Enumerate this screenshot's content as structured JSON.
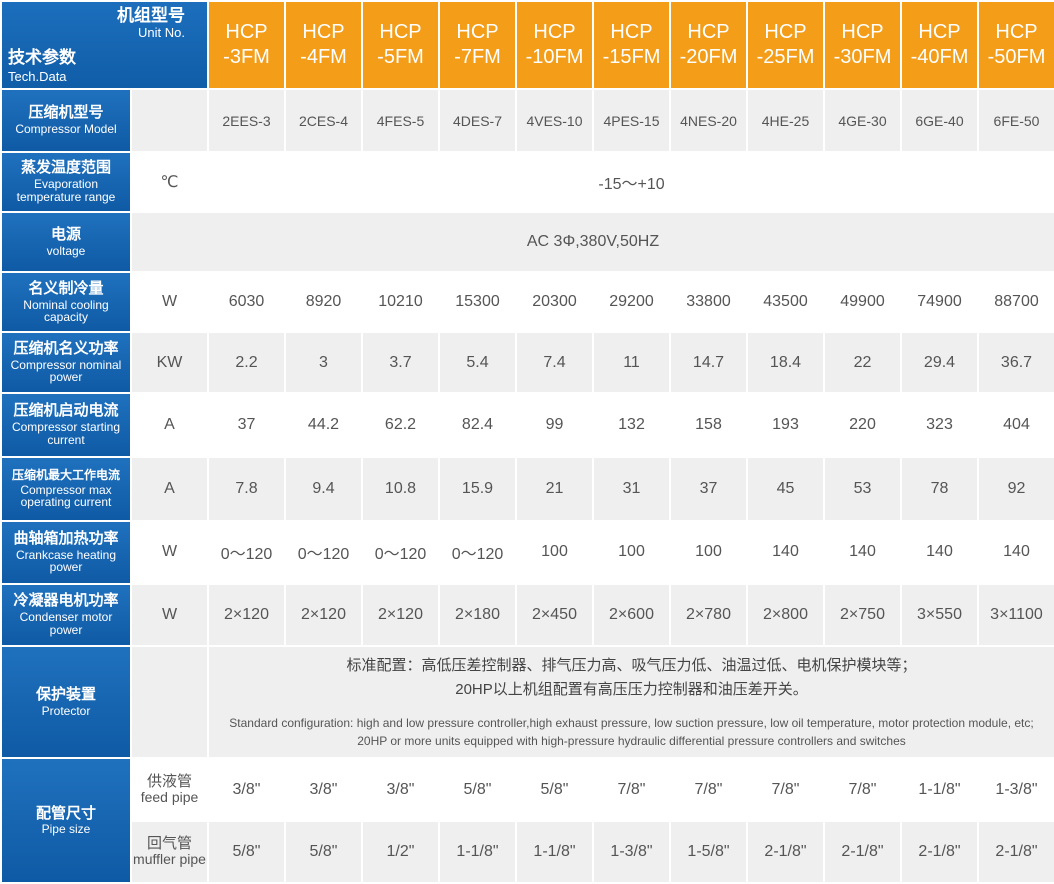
{
  "header": {
    "unit_no_zh": "机组型号",
    "unit_no_en": "Unit No.",
    "tech_zh": "技术参数",
    "tech_en": "Tech.Data",
    "models": [
      [
        "HCP",
        "-3FM"
      ],
      [
        "HCP",
        "-4FM"
      ],
      [
        "HCP",
        "-5FM"
      ],
      [
        "HCP",
        "-7FM"
      ],
      [
        "HCP",
        "-10FM"
      ],
      [
        "HCP",
        "-15FM"
      ],
      [
        "HCP",
        "-20FM"
      ],
      [
        "HCP",
        "-25FM"
      ],
      [
        "HCP",
        "-30FM"
      ],
      [
        "HCP",
        "-40FM"
      ],
      [
        "HCP",
        "-50FM"
      ]
    ]
  },
  "rows": [
    {
      "zh": "压缩机型号",
      "en": "Compressor Model",
      "unit": "",
      "values": [
        "2EES-3",
        "2CES-4",
        "4FES-5",
        "4DES-7",
        "4VES-10",
        "4PES-15",
        "4NES-20",
        "4HE-25",
        "4GE-30",
        "6GE-40",
        "6FE-50"
      ]
    },
    {
      "zh": "蒸发温度范围",
      "en": "Evaporation temperature range",
      "unit": "℃",
      "span": "-15～+10"
    },
    {
      "zh": "电源",
      "en": "voltage",
      "unit": "",
      "span": "AC 3Φ,380V,50HZ"
    },
    {
      "zh": "名义制冷量",
      "en": "Nominal cooling capacity",
      "unit": "W",
      "values": [
        "6030",
        "8920",
        "10210",
        "15300",
        "20300",
        "29200",
        "33800",
        "43500",
        "49900",
        "74900",
        "88700"
      ]
    },
    {
      "zh": "压缩机名义功率",
      "en": "Compressor nominal power",
      "unit": "KW",
      "values": [
        "2.2",
        "3",
        "3.7",
        "5.4",
        "7.4",
        "11",
        "14.7",
        "18.4",
        "22",
        "29.4",
        "36.7"
      ]
    },
    {
      "zh": "压缩机启动电流",
      "en": "Compressor starting current",
      "unit": "A",
      "values": [
        "37",
        "44.2",
        "62.2",
        "82.4",
        "99",
        "132",
        "158",
        "193",
        "220",
        "323",
        "404"
      ]
    },
    {
      "zh": "压缩机最大工作电流",
      "en": "Compressor max operating current",
      "unit": "A",
      "values": [
        "7.8",
        "9.4",
        "10.8",
        "15.9",
        "21",
        "31",
        "37",
        "45",
        "53",
        "78",
        "92"
      ]
    },
    {
      "zh": "曲轴箱加热功率",
      "en": "Crankcase heating power",
      "unit": "W",
      "values": [
        "0～120",
        "0～120",
        "0～120",
        "0～120",
        "100",
        "100",
        "100",
        "140",
        "140",
        "140",
        "140"
      ]
    },
    {
      "zh": "冷凝器电机功率",
      "en": "Condenser motor power",
      "unit": "W",
      "values": [
        "2×120",
        "2×120",
        "2×120",
        "2×180",
        "2×450",
        "2×600",
        "2×780",
        "2×800",
        "2×750",
        "3×550",
        "3×1100"
      ]
    }
  ],
  "protector": {
    "zh": "保护装置",
    "en": "Protector",
    "desc_zh_1": "标准配置：高低压差控制器、排气压力高、吸气压力低、油温过低、电机保护模块等；",
    "desc_zh_2": "20HP以上机组配置有高压压力控制器和油压差开关。",
    "desc_en": "Standard configuration: high and low pressure controller,high exhaust pressure, low suction pressure, low oil temperature, motor protection module, etc; 20HP or more units equipped with high-pressure hydraulic differential pressure controllers and switches"
  },
  "pipe": {
    "zh": "配管尺寸",
    "en": "Pipe size",
    "feed": {
      "zh": "供液管",
      "en": "feed pipe",
      "values": [
        "3/8\"",
        "3/8\"",
        "3/8\"",
        "5/8\"",
        "5/8\"",
        "7/8\"",
        "7/8\"",
        "7/8\"",
        "7/8\"",
        "1-1/8\"",
        "1-3/8\""
      ]
    },
    "muffler": {
      "zh": "回气管",
      "en": "muffler pipe",
      "values": [
        "5/8\"",
        "5/8\"",
        "1/2\"",
        "1-1/8\"",
        "1-1/8\"",
        "1-3/8\"",
        "1-5/8\"",
        "2-1/8\"",
        "2-1/8\"",
        "2-1/8\"",
        "2-1/8\""
      ]
    }
  },
  "colors": {
    "label_blue": "#1565b5",
    "header_orange": "#f39d18",
    "odd_row": "#efefef"
  }
}
